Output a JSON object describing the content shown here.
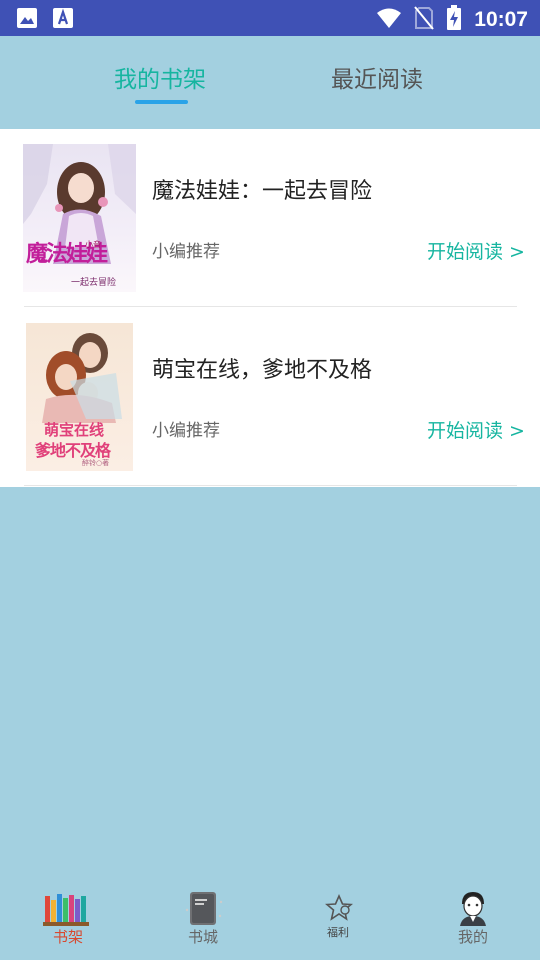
{
  "status_bar": {
    "time": "10:07",
    "left_icons": [
      "image-icon",
      "font-download-icon"
    ],
    "right_icons": [
      "wifi-icon",
      "no-sim-icon",
      "battery-charging-icon"
    ]
  },
  "tabs": [
    {
      "label": "我的书架",
      "active": true
    },
    {
      "label": "最近阅读",
      "active": false
    }
  ],
  "books": [
    {
      "title": "魔法娃娃：一起去冒险",
      "subtitle": "小编推荐",
      "action": "开始阅读 >",
      "cover": {
        "title_art": "魔法娃娃",
        "author_seal": "小音",
        "tagline": "一起去冒险"
      }
    },
    {
      "title": "萌宝在线，爹地不及格",
      "subtitle": "小编推荐",
      "action": "开始阅读 >",
      "cover": {
        "title_art_line1": "萌宝在线",
        "title_art_line2": "爹地不及格",
        "author": "醉铃○著"
      }
    }
  ],
  "bottom_nav": [
    {
      "label": "书架",
      "icon": "bookshelf-icon",
      "active": true
    },
    {
      "label": "书城",
      "icon": "book-store-icon",
      "active": false
    },
    {
      "label": "福利",
      "icon": "star-gift-icon",
      "active": false
    },
    {
      "label": "我的",
      "icon": "profile-avatar-icon",
      "active": false
    }
  ],
  "colors": {
    "status_bar": "#3f51b5",
    "background": "#a3d0e0",
    "accent": "#16b5a0",
    "indicator": "#2aa3e8"
  }
}
